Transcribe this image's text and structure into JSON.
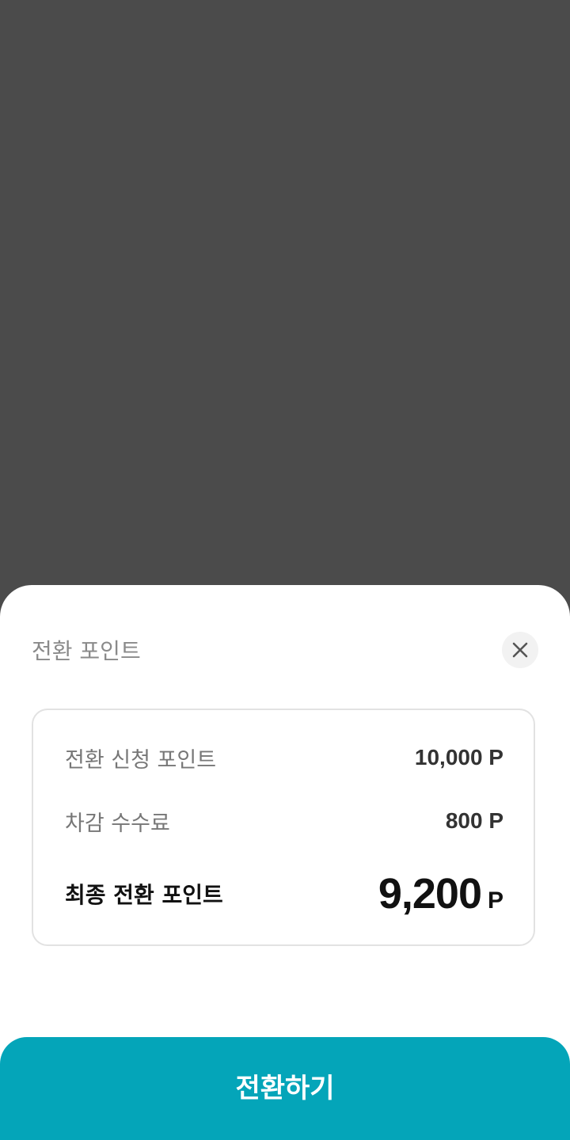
{
  "sheet": {
    "title": "전환 포인트",
    "close_icon": "close-icon"
  },
  "summary": {
    "requested": {
      "label": "전환 신청 포인트",
      "value": "10,000 P"
    },
    "fee": {
      "label": "차감 수수료",
      "value": "800 P"
    },
    "final": {
      "label": "최종 전환 포인트",
      "value": "9,200",
      "unit": "P"
    }
  },
  "action": {
    "convert_label": "전환하기"
  },
  "colors": {
    "overlay": "#4b4b4b",
    "accent": "#04a5b9"
  }
}
